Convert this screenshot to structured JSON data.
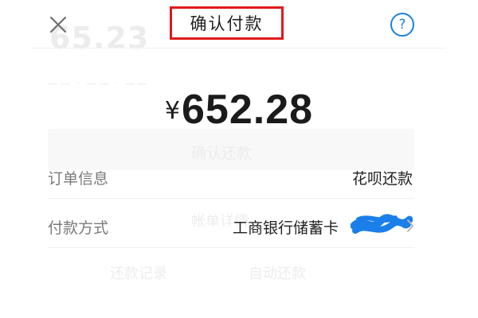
{
  "header": {
    "title": "确认付款",
    "close_icon": "close-icon",
    "help_icon": "help-icon",
    "help_glyph": "?"
  },
  "amount": {
    "currency_symbol": "¥",
    "value": "652.28"
  },
  "rows": {
    "order": {
      "label": "订单信息",
      "value": "花呗还款"
    },
    "payment_method": {
      "label": "付款方式",
      "value": "工商银行储蓄卡",
      "suffix_icon": "chevron-right-icon"
    }
  },
  "background_page": {
    "amount": "65.23",
    "button_label": "确认还款",
    "center_text": "帐单详情",
    "left_link": "还款记录",
    "right_link": "自动还款"
  },
  "colors": {
    "title_highlight_border": "#e11a1a",
    "help_icon": "#1a82e0",
    "redaction": "#1a7fe8",
    "label_text": "#7a7a7a",
    "primary_text": "#222222"
  }
}
